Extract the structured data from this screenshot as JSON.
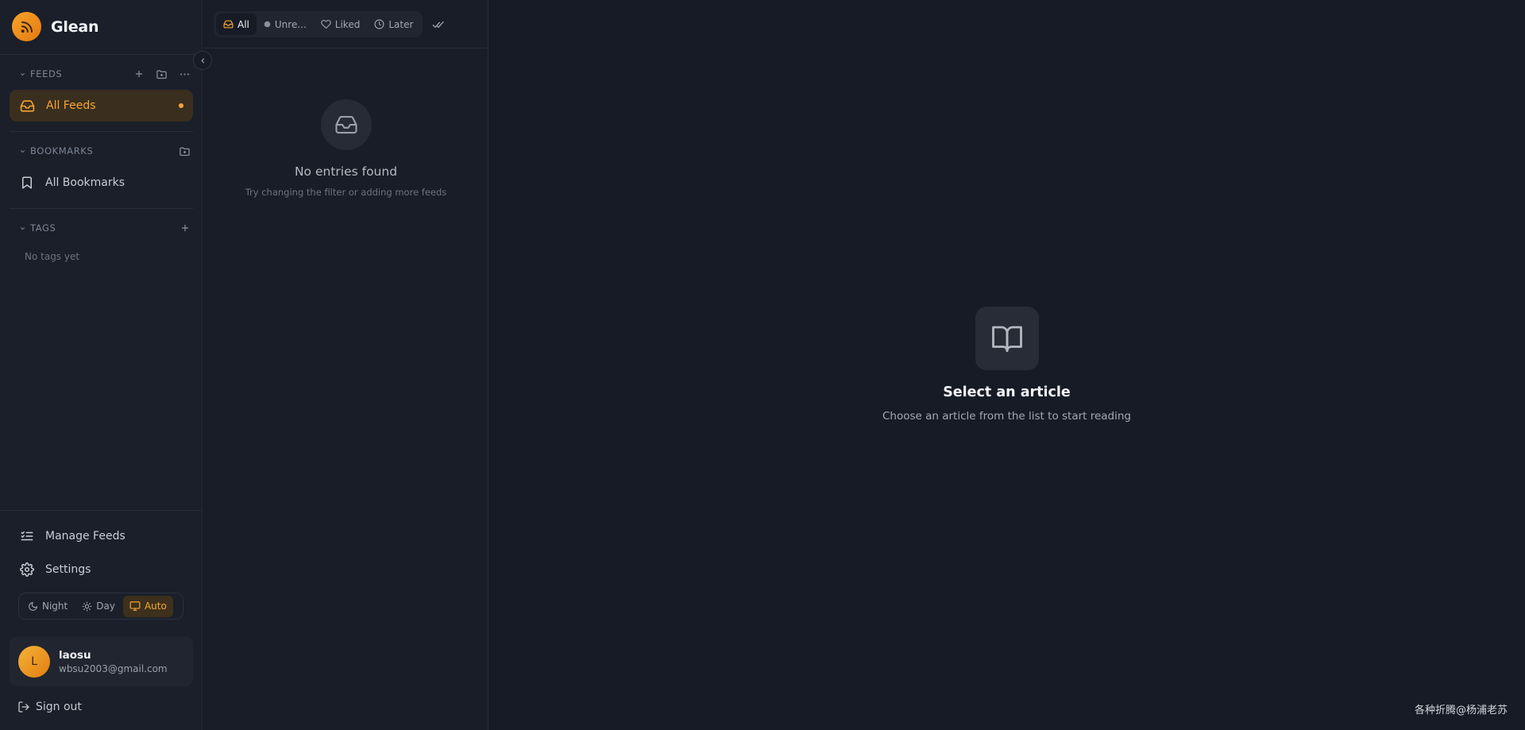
{
  "app": {
    "name": "Glean",
    "logo_icon": "rss-icon",
    "accent": "#f7a532"
  },
  "sidebar": {
    "feeds": {
      "title": "FEEDS",
      "actions": [
        "plus-icon",
        "folder-plus-icon",
        "more-horizontal-icon"
      ],
      "items": [
        {
          "label": "All Feeds",
          "icon": "inbox-icon",
          "active": true,
          "unread_dot": true
        }
      ]
    },
    "bookmarks": {
      "title": "BOOKMARKS",
      "actions": [
        "folder-plus-icon"
      ],
      "items": [
        {
          "label": "All Bookmarks",
          "icon": "bookmark-icon"
        }
      ]
    },
    "tags": {
      "title": "TAGS",
      "actions": [
        "plus-icon"
      ],
      "empty_text": "No tags yet"
    },
    "bottom": {
      "manage_feeds": "Manage Feeds",
      "settings": "Settings",
      "theme": {
        "options": [
          "Night",
          "Day",
          "Auto"
        ],
        "selected": "Auto"
      },
      "user": {
        "initial": "L",
        "name": "laosu",
        "email": "wbsu2003@gmail.com"
      },
      "sign_out": "Sign out"
    }
  },
  "entry_list": {
    "filters": [
      "All",
      "Unre...",
      "Liked",
      "Later"
    ],
    "selected_filter": "All",
    "empty": {
      "title": "No entries found",
      "subtitle": "Try changing the filter or adding more feeds"
    }
  },
  "reader": {
    "empty": {
      "title": "Select an article",
      "subtitle": "Choose an article from the list to start reading"
    }
  },
  "watermark": "各种折腾@杨浦老苏"
}
